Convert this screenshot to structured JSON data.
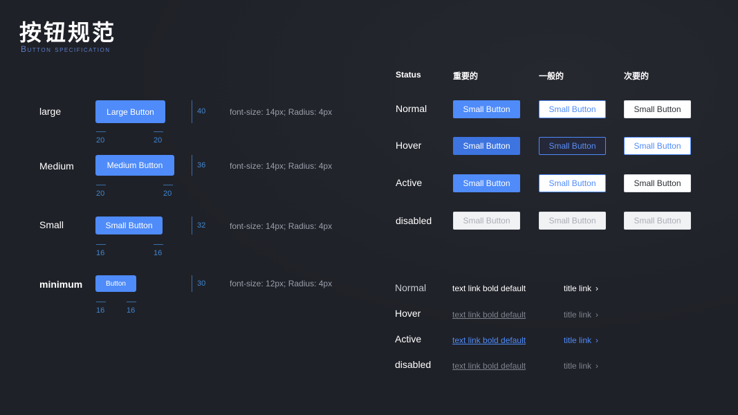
{
  "header": {
    "title": "按钮规范",
    "subtitle": "Button specification"
  },
  "sizes": [
    {
      "label": "large",
      "button": "Large Button",
      "height": "40",
      "pad_left": "20",
      "pad_right": "20",
      "spec": "font-size: 14px; Radius: 4px"
    },
    {
      "label": "Medium",
      "button": "Medium Button",
      "height": "36",
      "pad_left": "20",
      "pad_right": "20",
      "spec": "font-size: 14px; Radius: 4px"
    },
    {
      "label": "Small",
      "button": "Small Button",
      "height": "32",
      "pad_left": "16",
      "pad_right": "16",
      "spec": "font-size: 14px; Radius: 4px"
    },
    {
      "label": "minimum",
      "button": "Button",
      "height": "30",
      "pad_left": "16",
      "pad_right": "16",
      "spec": "font-size: 12px; Radius: 4px"
    }
  ],
  "status_table": {
    "headers": [
      "Status",
      "重要的",
      "一般的",
      "次要的"
    ],
    "rows": [
      {
        "label": "Normal",
        "buttons": [
          "Small Button",
          "Small Button",
          "Small Button"
        ]
      },
      {
        "label": "Hover",
        "buttons": [
          "Small Button",
          "Small Button",
          "Small Button"
        ]
      },
      {
        "label": "Active",
        "buttons": [
          "Small Button",
          "Small Button",
          "Small Button"
        ]
      },
      {
        "label": "disabled",
        "buttons": [
          "Small Button",
          "Small Button",
          "Small Button"
        ]
      }
    ]
  },
  "links": [
    {
      "label": "Normal",
      "text_link": "text link bold default",
      "title_link": "title link"
    },
    {
      "label": "Hover",
      "text_link": "text link bold default",
      "title_link": "title link"
    },
    {
      "label": "Active",
      "text_link": "text link bold default",
      "title_link": "title link"
    },
    {
      "label": "disabled",
      "text_link": "text link bold default",
      "title_link": "title link"
    }
  ],
  "colors": {
    "primary": "#4f8bf9",
    "background": "#1f2128",
    "measure": "#3f86cf"
  }
}
